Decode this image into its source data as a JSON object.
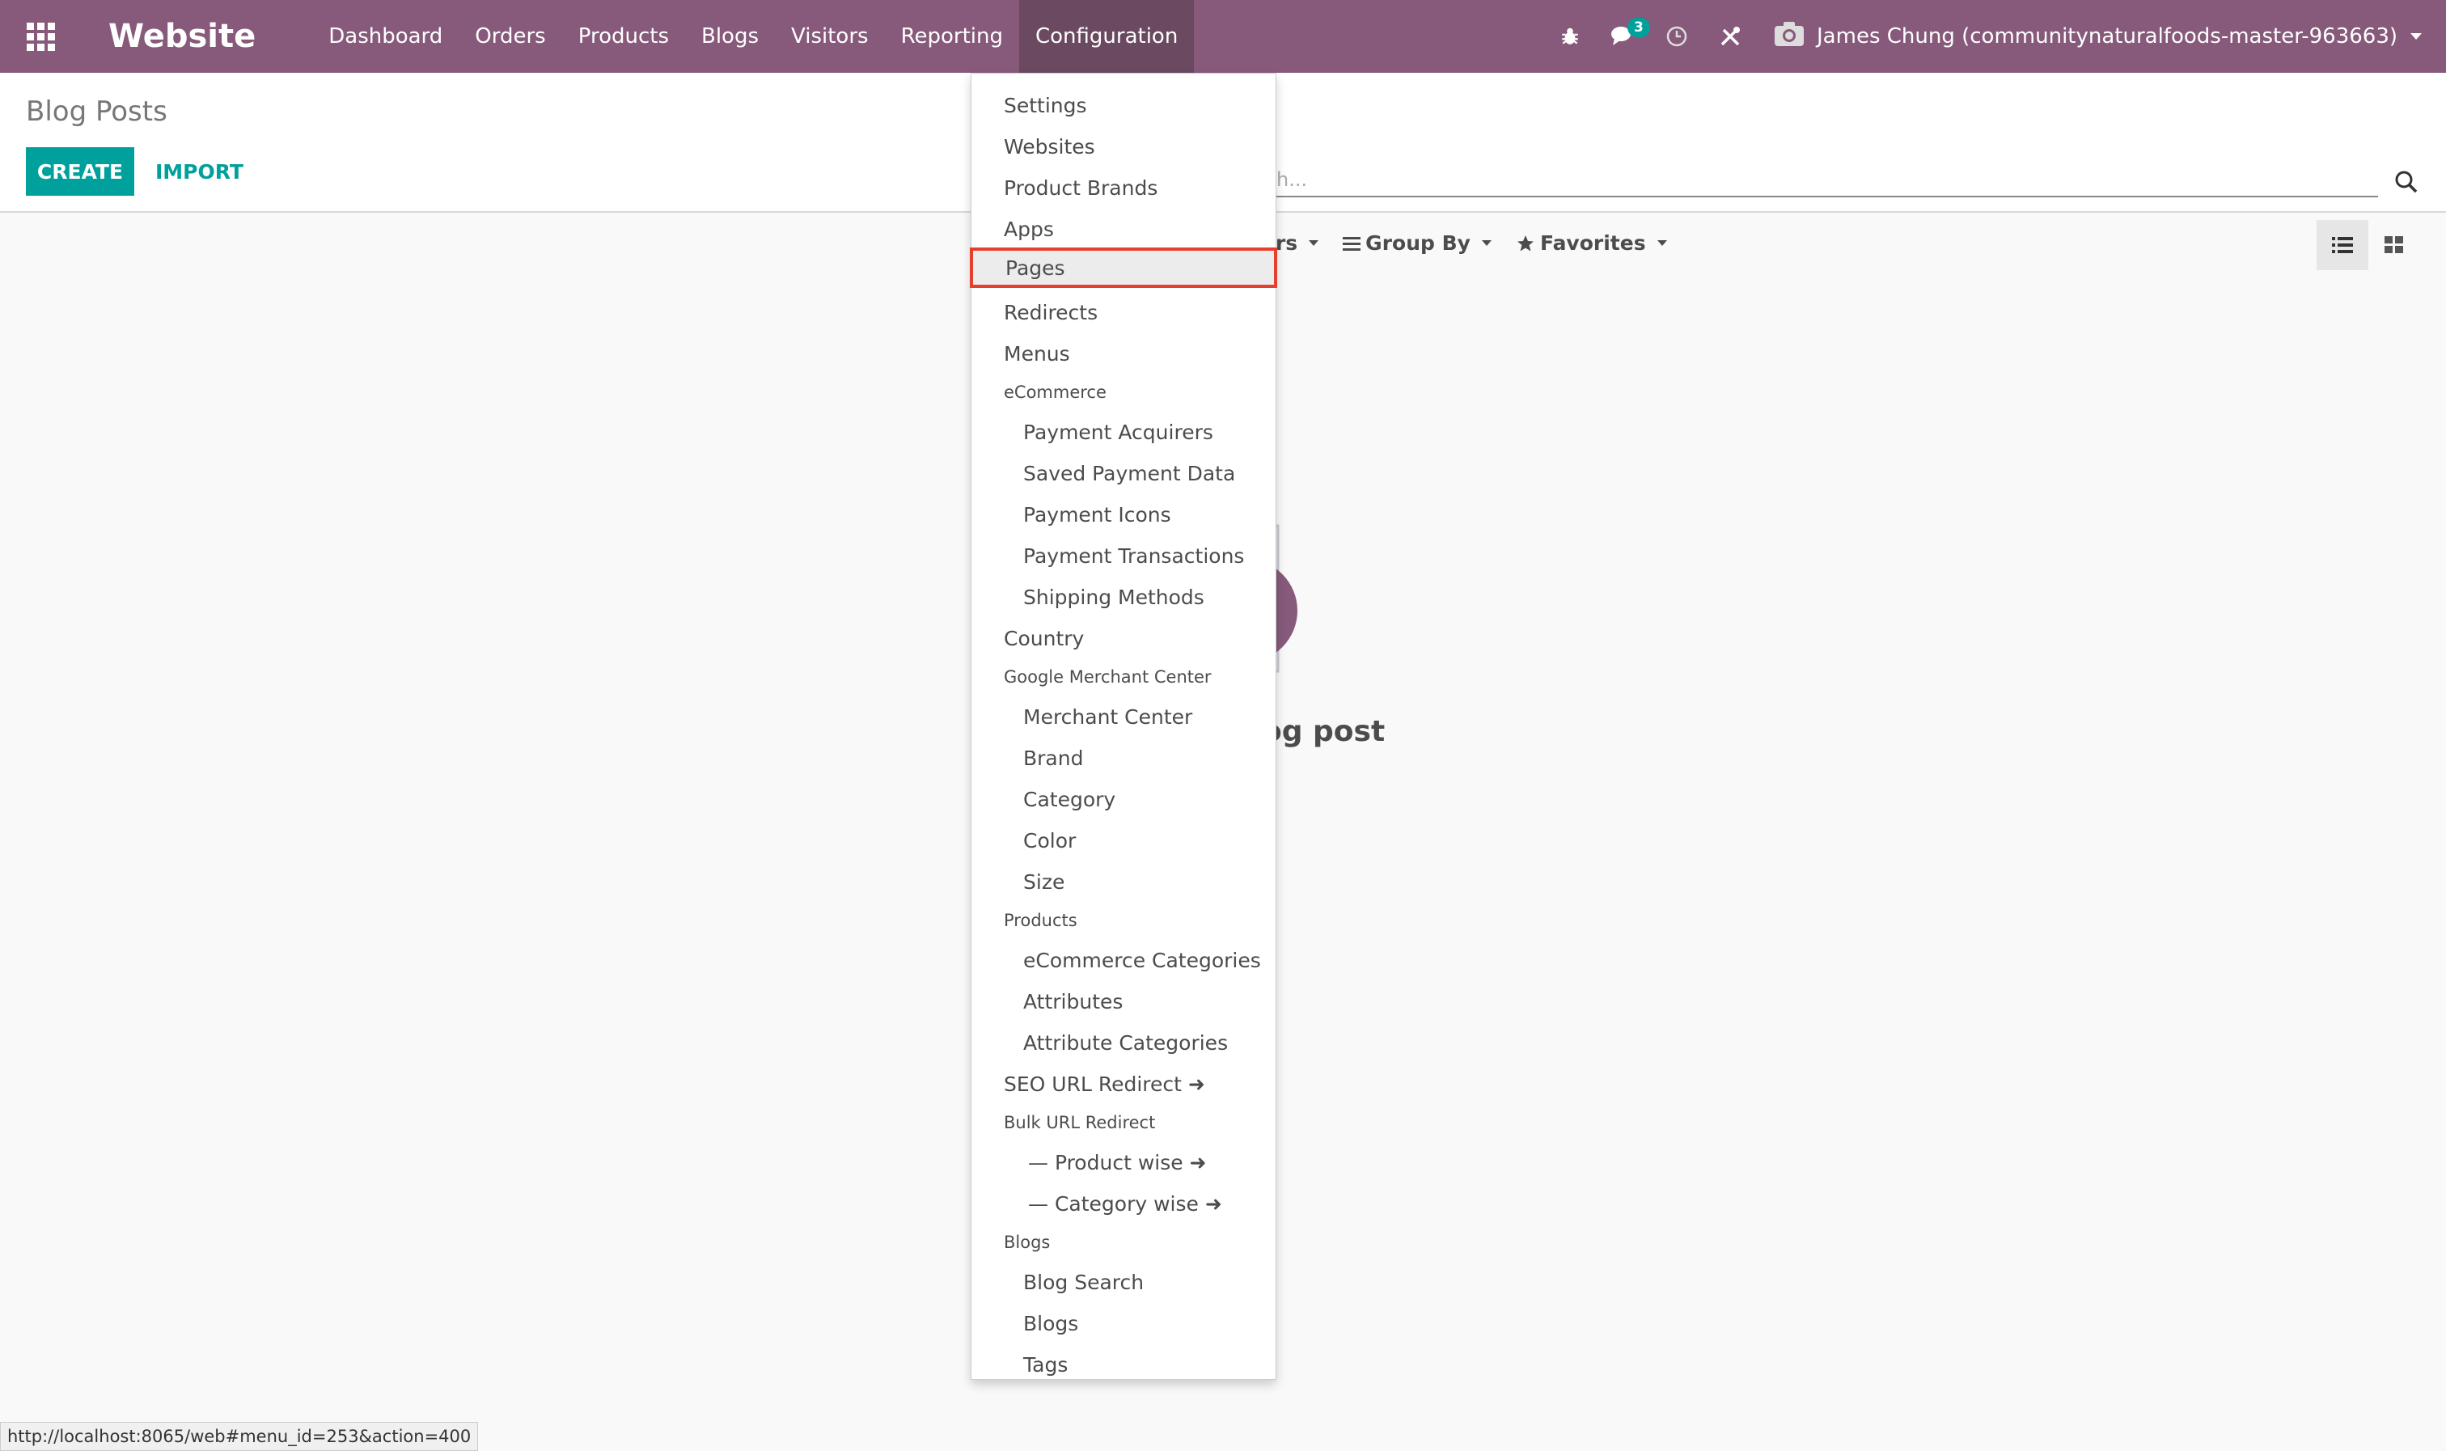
{
  "navbar": {
    "brand": "Website",
    "menu": [
      "Dashboard",
      "Orders",
      "Products",
      "Blogs",
      "Visitors",
      "Reporting",
      "Configuration"
    ],
    "messages_badge": "3",
    "user_name": "James Chung (communitynaturalfoods-master-963663)",
    "color": "#875a7b"
  },
  "control_panel": {
    "breadcrumb": "Blog Posts",
    "create_label": "CREATE",
    "import_label": "IMPORT",
    "search_placeholder": "Search...",
    "search_visible_fragment": "h...",
    "filters_label_fragment": "ers",
    "group_by_label": "Group By",
    "favorites_label": "Favorites",
    "accent": "#00a09d"
  },
  "empty_state": {
    "text_fragment": "og post"
  },
  "dropdown": {
    "items": [
      {
        "label": "Settings",
        "level": 0
      },
      {
        "label": "Websites",
        "level": 0
      },
      {
        "label": "Product Brands",
        "level": 0
      },
      {
        "label": "Apps",
        "level": 0
      },
      {
        "label": "Pages",
        "level": 0,
        "highlighted": true
      },
      {
        "label": "Redirects",
        "level": 0
      },
      {
        "label": "Menus",
        "level": 0
      },
      {
        "label": "eCommerce",
        "header": true
      },
      {
        "label": "Payment Acquirers",
        "level": 1
      },
      {
        "label": "Saved Payment Data",
        "level": 1
      },
      {
        "label": "Payment Icons",
        "level": 1
      },
      {
        "label": "Payment Transactions",
        "level": 1
      },
      {
        "label": "Shipping Methods",
        "level": 1
      },
      {
        "label": "Country",
        "level": 0
      },
      {
        "label": "Google Merchant Center",
        "header": true
      },
      {
        "label": "Merchant Center",
        "level": 1
      },
      {
        "label": "Brand",
        "level": 1
      },
      {
        "label": "Category",
        "level": 1
      },
      {
        "label": "Color",
        "level": 1
      },
      {
        "label": "Size",
        "level": 1
      },
      {
        "label": "Products",
        "header": true
      },
      {
        "label": "eCommerce Categories",
        "level": 1
      },
      {
        "label": "Attributes",
        "level": 1
      },
      {
        "label": "Attribute Categories",
        "level": 1
      },
      {
        "label": "SEO URL Redirect ➜",
        "level": 0
      },
      {
        "label": "Bulk URL Redirect",
        "header": true
      },
      {
        "label": "— Product wise ➜",
        "level": 2
      },
      {
        "label": "— Category wise ➜",
        "level": 2
      },
      {
        "label": "Blogs",
        "header": true
      },
      {
        "label": "Blog Search",
        "level": 1
      },
      {
        "label": "Blogs",
        "level": 1
      },
      {
        "label": "Tags",
        "level": 1
      }
    ],
    "highlight_color": "#e4402d"
  },
  "status_bar": {
    "url": "http://localhost:8065/web#menu_id=253&action=400"
  }
}
